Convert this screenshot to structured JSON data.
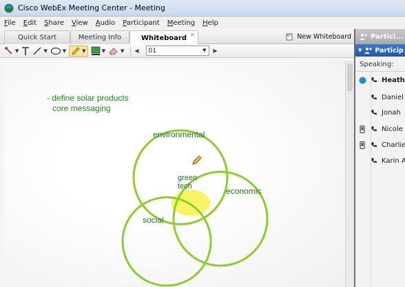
{
  "window": {
    "title": "Cisco WebEx Meeting Center - Meeting"
  },
  "menu": [
    {
      "label": "File",
      "u": "F",
      "rest": "ile"
    },
    {
      "label": "Edit",
      "u": "E",
      "rest": "dit"
    },
    {
      "label": "Share",
      "u": "S",
      "rest": "hare"
    },
    {
      "label": "View",
      "u": "V",
      "rest": "iew"
    },
    {
      "label": "Audio",
      "u": "A",
      "rest": "udio"
    },
    {
      "label": "Participant",
      "u": "P",
      "rest": "articipant"
    },
    {
      "label": "Meeting",
      "u": "M",
      "rest": "eeting"
    },
    {
      "label": "Help",
      "u": "H",
      "rest": "elp"
    }
  ],
  "tabs": {
    "quick_start": "Quick Start",
    "meeting_info": "Meeting Info",
    "whiteboard": "Whiteboard",
    "close_glyph": "×",
    "new_whiteboard": "New Whiteboard"
  },
  "toolbar": {
    "page_value": "01",
    "prev_glyph": "◀",
    "next_glyph": "▶"
  },
  "whiteboard": {
    "note_line1": "- define solar products",
    "note_line2": "core messaging",
    "label_environmental": "environmental",
    "label_economic": "economic",
    "label_social": "social",
    "label_center1": "green",
    "label_center2": "tech",
    "ink_color": "#8ccc2b",
    "highlight_color": "#f7f24a"
  },
  "participants_panel": {
    "tab_label": "Partici...",
    "header_label": "Particip",
    "speaking_label": "Speaking:",
    "people": [
      {
        "name": "Heath",
        "host": true,
        "globe": true,
        "mobile": false
      },
      {
        "name": "Daniel",
        "host": false,
        "globe": false,
        "mobile": false
      },
      {
        "name": "Jonah",
        "host": false,
        "globe": false,
        "mobile": false
      },
      {
        "name": "Nicole",
        "host": false,
        "globe": false,
        "mobile": true
      },
      {
        "name": "Charlie",
        "host": false,
        "globe": false,
        "mobile": true
      },
      {
        "name": "Karin A",
        "host": false,
        "globe": false,
        "mobile": false
      }
    ]
  },
  "colors": {
    "title_bar": "#c9d9ee",
    "accent_blue": "#2456a6",
    "ink_text": "#1b8a1b"
  }
}
